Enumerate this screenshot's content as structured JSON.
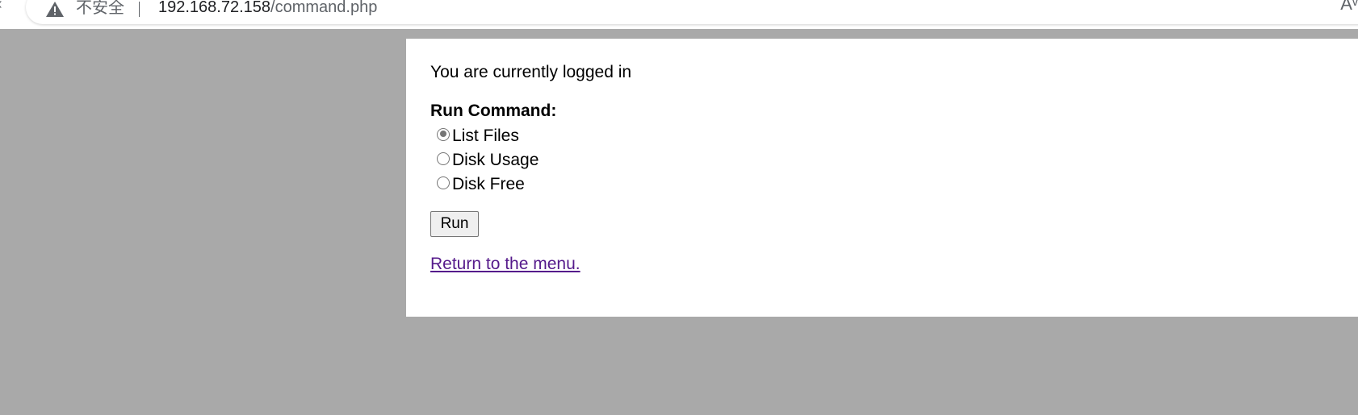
{
  "browser": {
    "security_label": "不安全",
    "url_host": "192.168.72.158",
    "url_path": "/command.php",
    "icons": {
      "back": "back-arrow-icon",
      "warning": "warning-triangle-icon",
      "reader": "read-aloud-icon"
    }
  },
  "page": {
    "status_text": "You are currently logged in",
    "section_heading": "Run Command:",
    "options": [
      {
        "label": "List Files",
        "checked": true
      },
      {
        "label": "Disk Usage",
        "checked": false
      },
      {
        "label": "Disk Free",
        "checked": false
      }
    ],
    "run_button_label": "Run",
    "return_link_text": "Return to the menu."
  },
  "colors": {
    "page_background": "#a9a9a9",
    "panel_background": "#ffffff",
    "visited_link": "#551a8b"
  }
}
